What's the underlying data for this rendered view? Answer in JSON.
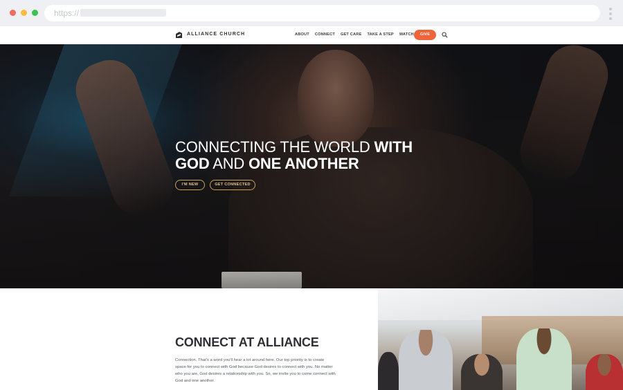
{
  "browser": {
    "url_scheme": "https://"
  },
  "nav": {
    "logo_text": "ALLIANCE CHURCH",
    "links": [
      "ABOUT",
      "CONNECT",
      "GET CARE",
      "TAKE A STEP",
      "WATCH"
    ],
    "give_label": "GIVE"
  },
  "hero": {
    "headline_part1": "CONNECTING THE WORLD ",
    "headline_bold1": "WITH",
    "headline_bold2": "GOD",
    "headline_part2": " AND ",
    "headline_bold3": "ONE ANOTHER",
    "button_new": "I'M NEW",
    "button_connected": "GET CONNECTED"
  },
  "section": {
    "title_bold": "CONNECT",
    "title_rest": " AT ALLIANCE",
    "body": "Connection. That's a word you'll hear a lot around here. Our top priority is to create space for you to connect with God because God desires to connect with you. No matter who you are, God desires a relationship with you. So, we invite you to come connect with God and one another."
  },
  "colors": {
    "accent": "#f0643a",
    "hero_button_border": "#c9a054"
  }
}
